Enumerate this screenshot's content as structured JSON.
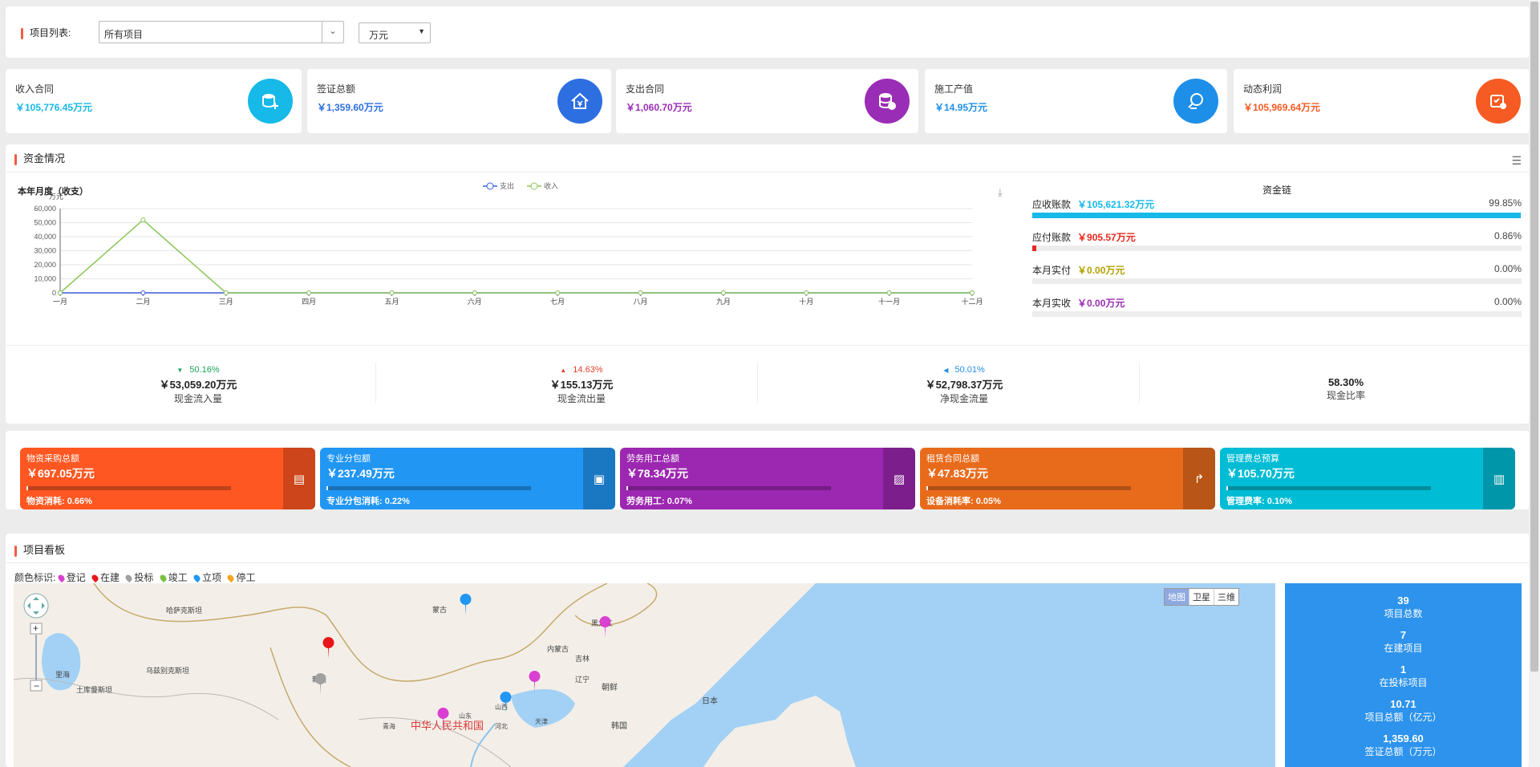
{
  "filter": {
    "label": "项目列表:",
    "project_value": "所有项目",
    "unit_value": "万元"
  },
  "stats": [
    {
      "title": "收入合同",
      "value": "￥105,776.45万元",
      "color": "#16b9e8",
      "icon": "coins-add-icon"
    },
    {
      "title": "签证总额",
      "value": "￥1,359.60万元",
      "color": "#2d6fe0",
      "icon": "house-yen-icon"
    },
    {
      "title": "支出合同",
      "value": "￥1,060.70万元",
      "color": "#9a2db5",
      "icon": "coins-stack-icon"
    },
    {
      "title": "施工产值",
      "value": "￥14.95万元",
      "color": "#1e8fe8",
      "icon": "wrench-icon"
    },
    {
      "title": "动态利润",
      "value": "￥105,969.64万元",
      "color": "#f55b22",
      "icon": "profit-icon"
    }
  ],
  "fund": {
    "title": "资金情况",
    "chart_subtitle": "本年月度（收支）",
    "chain_title": "资金链",
    "chain": [
      {
        "label": "应收账款",
        "value": "￥105,621.32万元",
        "percent": "99.85%",
        "fraction": 0.9985,
        "color": "#16b9e8"
      },
      {
        "label": "应付账款",
        "value": "￥905.57万元",
        "percent": "0.86%",
        "fraction": 0.0086,
        "color": "#e8281e"
      },
      {
        "label": "本月实付",
        "value": "￥0.00万元",
        "percent": "0.00%",
        "fraction": 0,
        "color": "#b3a100"
      },
      {
        "label": "本月实收",
        "value": "￥0.00万元",
        "percent": "0.00%",
        "fraction": 0,
        "color": "#9a2db5"
      }
    ],
    "flows": [
      {
        "change": "50.16%",
        "arrow": "▼",
        "change_color": "#1aa35a",
        "amount": "￥53,059.20万元",
        "label": "现金流入量"
      },
      {
        "change": "14.63%",
        "arrow": "▲",
        "change_color": "#e8402e",
        "amount": "￥155.13万元",
        "label": "现金流出量"
      },
      {
        "change": "50.01%",
        "arrow": "◀",
        "change_color": "#1e8fe8",
        "amount": "￥52,798.37万元",
        "label": "净现金流量"
      },
      {
        "change": "",
        "arrow": "",
        "change_color": "#333",
        "amount": "58.30%",
        "label": "现金比率"
      }
    ]
  },
  "chart_data": {
    "type": "line",
    "title": "",
    "ylabel": "万元",
    "categories": [
      "一月",
      "二月",
      "三月",
      "四月",
      "五月",
      "六月",
      "七月",
      "八月",
      "九月",
      "十月",
      "十一月",
      "十二月"
    ],
    "series": [
      {
        "name": "支出",
        "values": [
          0,
          0,
          0,
          0,
          0,
          0,
          0,
          0,
          0,
          0,
          0,
          0
        ],
        "color": "#3a5bd9"
      },
      {
        "name": "收入",
        "values": [
          0,
          52000,
          0,
          0,
          0,
          0,
          0,
          0,
          0,
          0,
          0,
          0
        ],
        "color": "#8dc65a"
      }
    ],
    "ylim": [
      0,
      60000
    ],
    "yticks": [
      "0",
      "10,000",
      "20,000",
      "30,000",
      "40,000",
      "50,000",
      "60,000"
    ],
    "legend_position": "top-center",
    "grid": true
  },
  "cards": [
    {
      "title": "物资采购总额",
      "value": "￥697.05万元",
      "rate": "物资消耗:  0.66%",
      "fraction": 0.0066,
      "color": "#ff5722",
      "icon": "invoice-icon"
    },
    {
      "title": "专业分包额",
      "value": "￥237.49万元",
      "rate": "专业分包消耗:  0.22%",
      "fraction": 0.0022,
      "color": "#2196f3",
      "icon": "chart-card-icon"
    },
    {
      "title": "劳务用工总额",
      "value": "￥78.34万元",
      "rate": "劳务用工:  0.07%",
      "fraction": 0.0007,
      "color": "#9c27b0",
      "icon": "worker-card-icon"
    },
    {
      "title": "租赁合同总额",
      "value": "￥47.83万元",
      "rate": "设备消耗率:  0.05%",
      "fraction": 0.0005,
      "color": "#e86b1c",
      "icon": "lease-icon"
    },
    {
      "title": "管理费总预算",
      "value": "￥105.70万元",
      "rate": "管理费率:  0.10%",
      "fraction": 0.001,
      "color": "#00bcd4",
      "icon": "budget-icon"
    }
  ],
  "board": {
    "title": "项目看板",
    "legend_label": "颜色标识:",
    "legend": [
      {
        "label": "登记",
        "color": "#d93fd0"
      },
      {
        "label": "在建",
        "color": "#e8161b"
      },
      {
        "label": "投标",
        "color": "#a0a0a0"
      },
      {
        "label": "竣工",
        "color": "#7ac143"
      },
      {
        "label": "立项",
        "color": "#2196f3"
      },
      {
        "label": "停工",
        "color": "#f5a623"
      }
    ],
    "map_types": [
      "地图",
      "卫星",
      "三维"
    ],
    "map_labels": [
      "蒙古",
      "哈萨克斯坦",
      "乌兹别克斯坦",
      "土库曼斯坦",
      "新疆",
      "内蒙古",
      "黑龙江",
      "吉林",
      "辽宁",
      "朝鲜",
      "日本",
      "韩国",
      "中华人民共和国",
      "里海",
      "青海",
      "山西",
      "河北",
      "山东",
      "天津"
    ],
    "summary": [
      {
        "num": "39",
        "label": "项目总数"
      },
      {
        "num": "7",
        "label": "在建项目"
      },
      {
        "num": "1",
        "label": "在投标项目"
      },
      {
        "num": "10.71",
        "label": "项目总额（亿元）"
      },
      {
        "num": "1,359.60",
        "label": "签证总额（万元）"
      }
    ]
  }
}
